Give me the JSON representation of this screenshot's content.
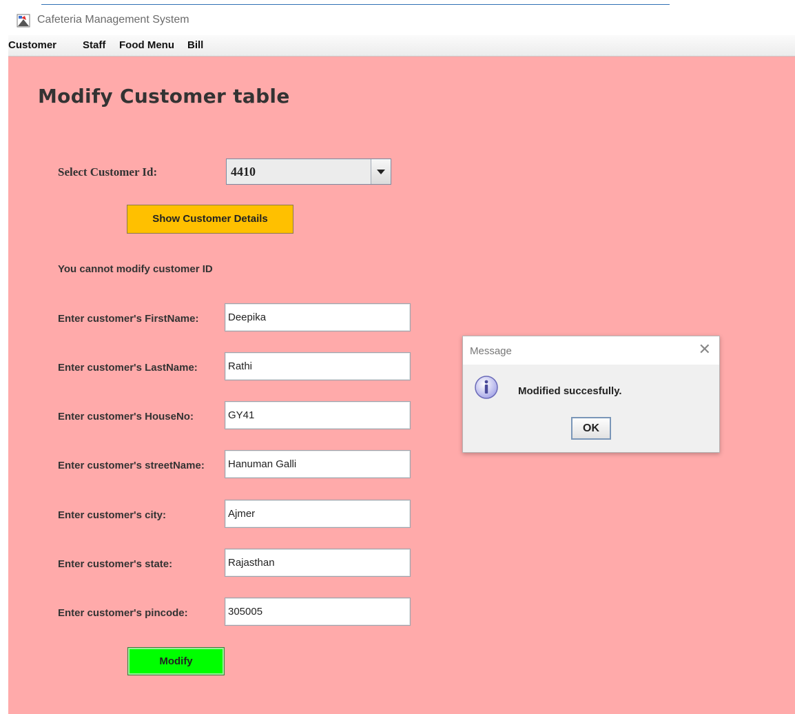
{
  "window": {
    "title": "Cafeteria Management System"
  },
  "menu": {
    "items": [
      {
        "label": "Customer"
      },
      {
        "label": "Staff"
      },
      {
        "label": "Food Menu"
      },
      {
        "label": "Bill"
      }
    ]
  },
  "form": {
    "title": "Modify Customer table",
    "select_id_label": "Select Customer Id:",
    "selected_id": "4410",
    "show_button": "Show Customer Details",
    "note": "You cannot modify customer ID",
    "fields": [
      {
        "label": "Enter customer's FirstName:",
        "value": "Deepika"
      },
      {
        "label": "Enter customer's LastName:",
        "value": "Rathi"
      },
      {
        "label": "Enter customer's HouseNo:",
        "value": "GY41"
      },
      {
        "label": "Enter customer's streetName:",
        "value": "Hanuman Galli"
      },
      {
        "label": "Enter customer's city:",
        "value": "Ajmer"
      },
      {
        "label": "Enter customer's state:",
        "value": "Rajasthan"
      },
      {
        "label": "Enter customer's pincode:",
        "value": "305005"
      }
    ],
    "modify_button": "Modify"
  },
  "dialog": {
    "title": "Message",
    "message": "Modified succesfully.",
    "ok_button": "OK",
    "icon": "info-icon"
  }
}
